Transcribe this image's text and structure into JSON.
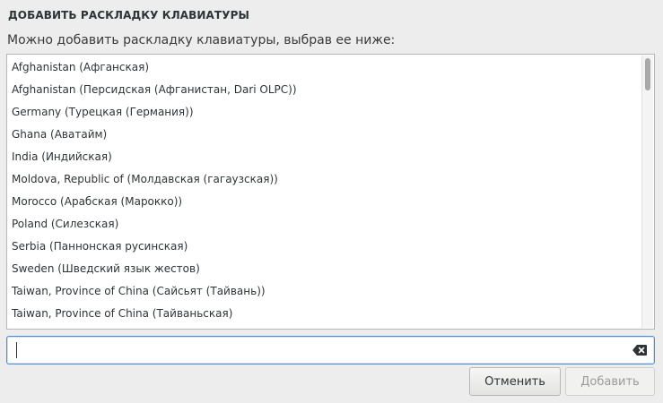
{
  "dialog": {
    "title": "ДОБАВИТЬ РАСКЛАДКУ КЛАВИАТУРЫ",
    "subtitle": "Можно добавить раскладку клавиатуры, выбрав ее ниже:"
  },
  "layouts": [
    "Afghanistan (Афганская)",
    "Afghanistan (Персидская (Афганистан, Dari OLPC))",
    "Germany (Турецкая (Германия))",
    "Ghana (Аватайм)",
    "India (Индийская)",
    "Moldova, Republic of (Молдавская (гагаузская))",
    "Morocco (Арабская (Марокко))",
    "Poland (Силезская)",
    "Serbia (Паннонская русинская)",
    "Sweden (Шведский язык жестов)",
    "Taiwan, Province of China (Сайсьят (Тайвань))",
    "Taiwan, Province of China (Тайваньская)"
  ],
  "search": {
    "value": "",
    "clear_icon": "backspace-clear-icon"
  },
  "buttons": {
    "cancel_label": "Отменить",
    "add_label": "Добавить",
    "add_enabled": false
  },
  "colors": {
    "background": "#ededed",
    "focus_border": "#4a90d9",
    "disabled_text": "#9a9a98"
  }
}
